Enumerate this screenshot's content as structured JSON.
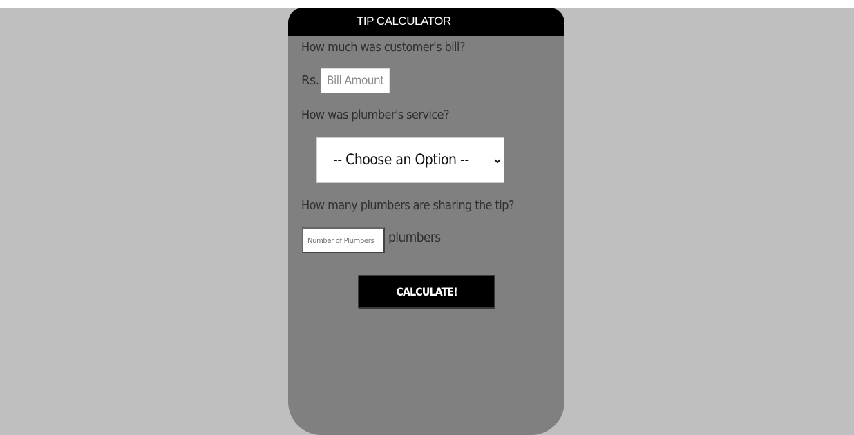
{
  "header": {
    "title": "TIP CALCULATOR"
  },
  "bill": {
    "question": "How much was customer's bill?",
    "currency": "Rs.",
    "placeholder": "Bill Amount",
    "value": ""
  },
  "service": {
    "question": "How was plumber's service?",
    "selected": "-- Choose an Option --"
  },
  "plumbers": {
    "question": "How many plumbers are sharing the tip?",
    "placeholder": "Number of Plumbers",
    "value": "",
    "unit": "plumbers"
  },
  "actions": {
    "calculate_label": "CALCULATE!"
  },
  "colors": {
    "page_background": "#bfbfbf",
    "card_background": "#808080",
    "header_background": "#000000",
    "button_background": "#000000"
  },
  "icons": {
    "select_arrow": "chevron-down-icon"
  }
}
